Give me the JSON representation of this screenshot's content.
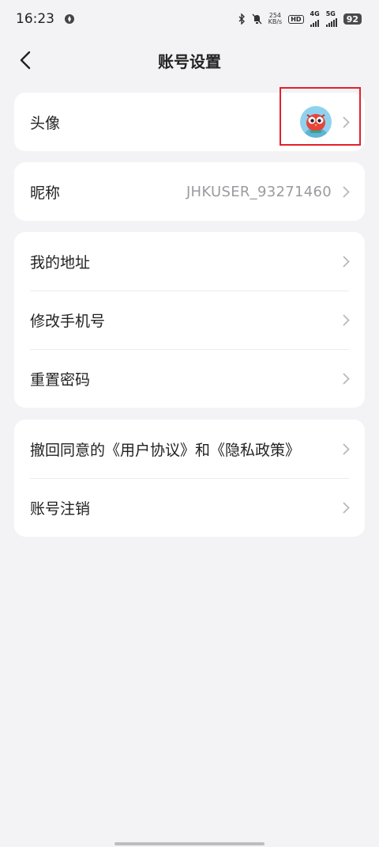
{
  "status_bar": {
    "time": "16:23",
    "network_speed_top": "254",
    "network_speed_unit": "KB/s",
    "hd_label": "HD",
    "net4g": "4G",
    "net5g": "5G",
    "battery": "92"
  },
  "header": {
    "title": "账号设置",
    "back_icon": "chevron-left-icon"
  },
  "sections": {
    "avatar": {
      "label": "头像",
      "icon": "owl-avatar-icon"
    },
    "nickname": {
      "label": "昵称",
      "value": "JHKUSER_93271460"
    },
    "address": {
      "label": "我的地址"
    },
    "phone": {
      "label": "修改手机号"
    },
    "password": {
      "label": "重置密码"
    },
    "revoke": {
      "label": "撤回同意的《用户协议》和《隐私政策》"
    },
    "cancel_account": {
      "label": "账号注销"
    }
  },
  "colors": {
    "background": "#f3f3f5",
    "card": "#ffffff",
    "highlight": "#e3212b",
    "secondary_text": "#9b9ba0"
  }
}
